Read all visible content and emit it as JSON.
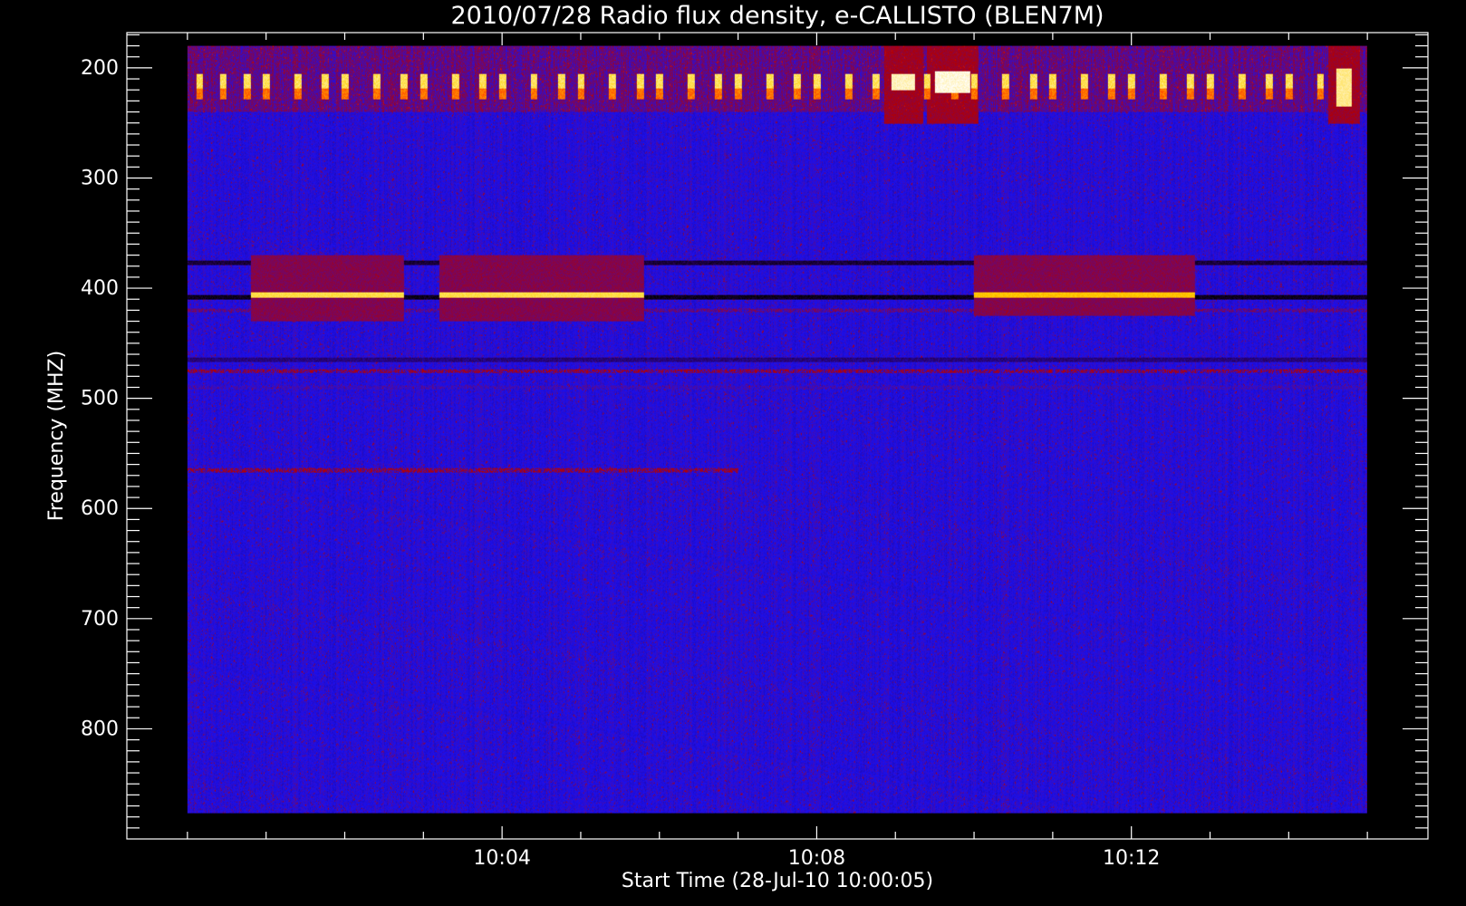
{
  "chart_data": {
    "type": "heatmap",
    "title": "2010/07/28  Radio flux density, e-CALLISTO (BLEN7M)",
    "xlabel": "Start Time (28-Jul-10 10:00:05)",
    "ylabel": "Frequency (MHZ)",
    "x_unit": "minutes after 10:00",
    "xlim": [
      -0.77,
      15.77
    ],
    "ylim": [
      168,
      900
    ],
    "y_inverted": true,
    "data_extent": {
      "x": [
        0.0,
        15.0
      ],
      "y": [
        180,
        877
      ]
    },
    "x_ticks": [
      {
        "value": 4,
        "label": "10:04"
      },
      {
        "value": 8,
        "label": "10:08"
      },
      {
        "value": 12,
        "label": "10:12"
      }
    ],
    "y_ticks": [
      {
        "value": 200,
        "label": "200"
      },
      {
        "value": 300,
        "label": "300"
      },
      {
        "value": 400,
        "label": "400"
      },
      {
        "value": 500,
        "label": "500"
      },
      {
        "value": 600,
        "label": "600"
      },
      {
        "value": 700,
        "label": "700"
      },
      {
        "value": 800,
        "label": "800"
      }
    ],
    "colormap": [
      "#000000",
      "#2a0060",
      "#1a10f0",
      "#b40000",
      "#ff2a00",
      "#ffd000",
      "#ffffff"
    ],
    "background_color": "#1a10f0",
    "features": {
      "periodic_bursts": {
        "freq_range": [
          205,
          228
        ],
        "times_min": [
          0.15,
          0.45,
          0.75,
          1.0,
          1.4,
          1.75,
          2.0,
          2.4,
          2.75,
          3.0,
          3.4,
          3.75,
          4.0,
          4.4,
          4.75,
          5.0,
          5.4,
          5.75,
          6.0,
          6.4,
          6.75,
          7.0,
          7.4,
          7.75,
          8.0,
          8.4,
          8.75,
          9.4,
          9.75,
          10.0,
          10.4,
          10.75,
          11.0,
          11.4,
          11.75,
          12.0,
          12.4,
          12.75,
          13.0,
          13.4,
          13.75,
          14.0,
          14.4,
          14.75
        ],
        "intensity": 0.85
      },
      "wide_bursts": [
        {
          "t": [
            8.95,
            9.25
          ],
          "freq": [
            205,
            220
          ],
          "intensity": 0.98
        },
        {
          "t": [
            9.5,
            9.95
          ],
          "freq": [
            203,
            222
          ],
          "intensity": 1.0
        },
        {
          "t": [
            14.6,
            14.8
          ],
          "freq": [
            200,
            235
          ],
          "intensity": 0.95
        }
      ],
      "emission_blocks": [
        {
          "t": [
            0.8,
            2.75
          ],
          "freq_band": [
            370,
            430
          ],
          "line_freq": 406,
          "line_intensity": 0.88
        },
        {
          "t": [
            3.2,
            5.8
          ],
          "freq_band": [
            370,
            430
          ],
          "line_freq": 406,
          "line_intensity": 0.88
        },
        {
          "t": [
            10.0,
            12.8
          ],
          "freq_band": [
            370,
            425
          ],
          "line_freq": 406,
          "line_intensity": 0.82
        }
      ],
      "dark_lines": [
        {
          "freq": 377,
          "intensity": 0.05
        },
        {
          "freq": 408,
          "intensity": 0.0
        },
        {
          "freq": 465,
          "intensity": 0.15
        }
      ],
      "faint_lines": [
        {
          "freq": 420,
          "intensity": 0.4
        },
        {
          "freq": 475,
          "intensity": 0.45
        },
        {
          "freq": 490,
          "intensity": 0.35
        },
        {
          "freq": 565,
          "t": [
            0.0,
            7.0
          ],
          "intensity": 0.45
        }
      ]
    }
  }
}
